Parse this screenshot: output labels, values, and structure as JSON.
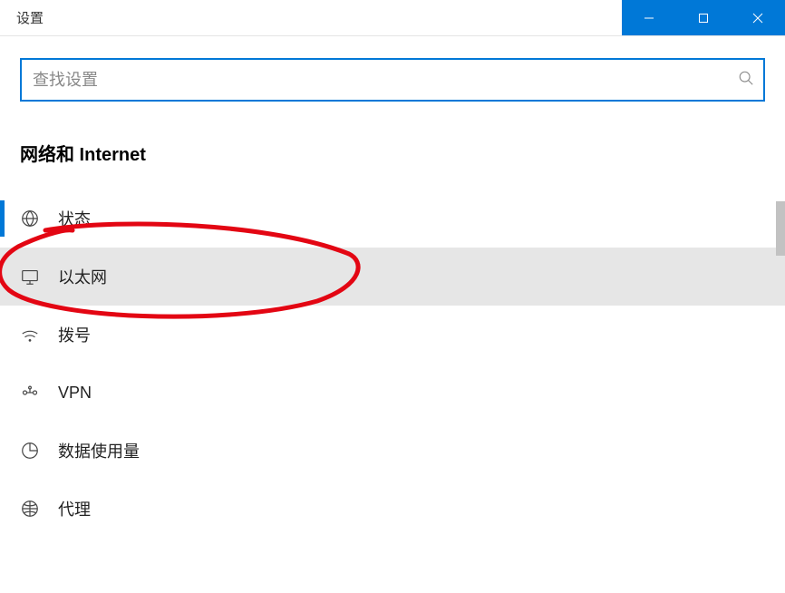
{
  "window": {
    "title": "设置"
  },
  "search": {
    "placeholder": "查找设置",
    "value": ""
  },
  "section": {
    "title": "网络和 Internet"
  },
  "nav": {
    "items": [
      {
        "label": "状态",
        "icon": "globe-status-icon",
        "state": "active"
      },
      {
        "label": "以太网",
        "icon": "ethernet-icon",
        "state": "hover"
      },
      {
        "label": "拨号",
        "icon": "dialup-icon",
        "state": ""
      },
      {
        "label": "VPN",
        "icon": "vpn-icon",
        "state": ""
      },
      {
        "label": "数据使用量",
        "icon": "data-usage-icon",
        "state": ""
      },
      {
        "label": "代理",
        "icon": "proxy-icon",
        "state": ""
      }
    ]
  },
  "annotation": {
    "description": "red hand-drawn circle around 以太网 item",
    "color": "#e30613"
  }
}
